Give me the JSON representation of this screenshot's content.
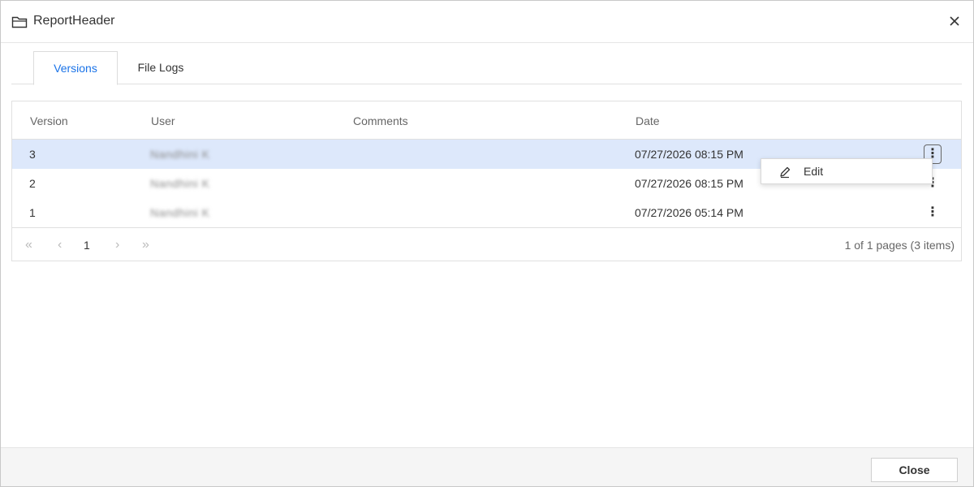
{
  "dialog": {
    "title": "ReportHeader"
  },
  "tabs": [
    {
      "label": "Versions"
    },
    {
      "label": "File Logs"
    }
  ],
  "grid": {
    "columns": [
      "Version",
      "User",
      "Comments",
      "Date"
    ],
    "rows": [
      {
        "version": "3",
        "user": "Nandhini K",
        "comments": "",
        "date": "07/27/2026 08:15 PM"
      },
      {
        "version": "2",
        "user": "Nandhini K",
        "comments": "",
        "date": "07/27/2026 08:15 PM"
      },
      {
        "version": "1",
        "user": "Nandhini K",
        "comments": "",
        "date": "07/27/2026 05:14 PM"
      }
    ],
    "kebab": "⋮"
  },
  "pager": {
    "first": "«",
    "prev": "‹",
    "page": "1",
    "next": "›",
    "last": "»",
    "info": "1 of 1 pages (3 items)"
  },
  "context_menu": {
    "edit_label": "Edit"
  },
  "footer": {
    "close_label": "Close"
  },
  "colors": {
    "accent": "#1a73e8",
    "selected_row": "#dde8fb"
  }
}
